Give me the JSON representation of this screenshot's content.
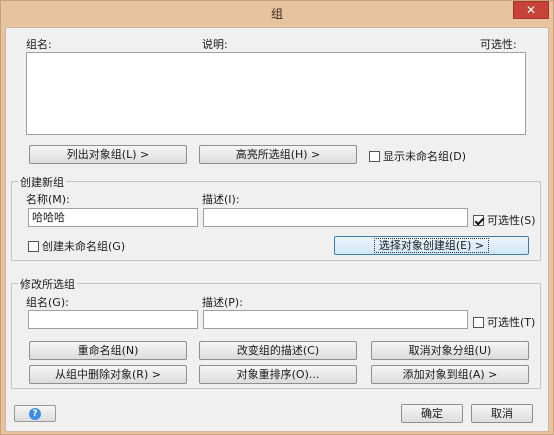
{
  "window": {
    "title": "组",
    "close_glyph": "✕"
  },
  "list": {
    "col_group_name": "组名:",
    "col_description": "说明:",
    "col_selectable": "可选性:"
  },
  "top_buttons": {
    "list_groups": "列出对象组(L) >",
    "highlight": "高亮所选组(H) >",
    "show_unnamed": "显示未命名组(D)"
  },
  "create": {
    "title": "创建新组",
    "name_label": "名称(M):",
    "name_value": "哈哈哈",
    "desc_label": "描述(I):",
    "desc_value": "",
    "selectable": "可选性(S)",
    "unnamed": "创建未命名组(G)",
    "select_create": "选择对象创建组(E) >"
  },
  "modify": {
    "title": "修改所选组",
    "group_name_label": "组名(G):",
    "group_name_value": "",
    "desc_label": "描述(P):",
    "desc_value": "",
    "selectable": "可选性(T)",
    "rename": "重命名组(N)",
    "change_desc": "改变组的描述(C)",
    "ungroup": "取消对象分组(U)",
    "remove_objects": "从组中删除对象(R) >",
    "reorder": "对象重排序(O)...",
    "add_objects": "添加对象到组(A) >"
  },
  "footer": {
    "ok": "确定",
    "cancel": "取消",
    "help_glyph": "?"
  },
  "checkbox_state": {
    "show_unnamed": false,
    "create_selectable": true,
    "create_unnamed": false,
    "modify_selectable": false
  },
  "colors": {
    "accent": "#3f8ee6",
    "close": "#c7433a",
    "frame": "#e7c3a0"
  }
}
